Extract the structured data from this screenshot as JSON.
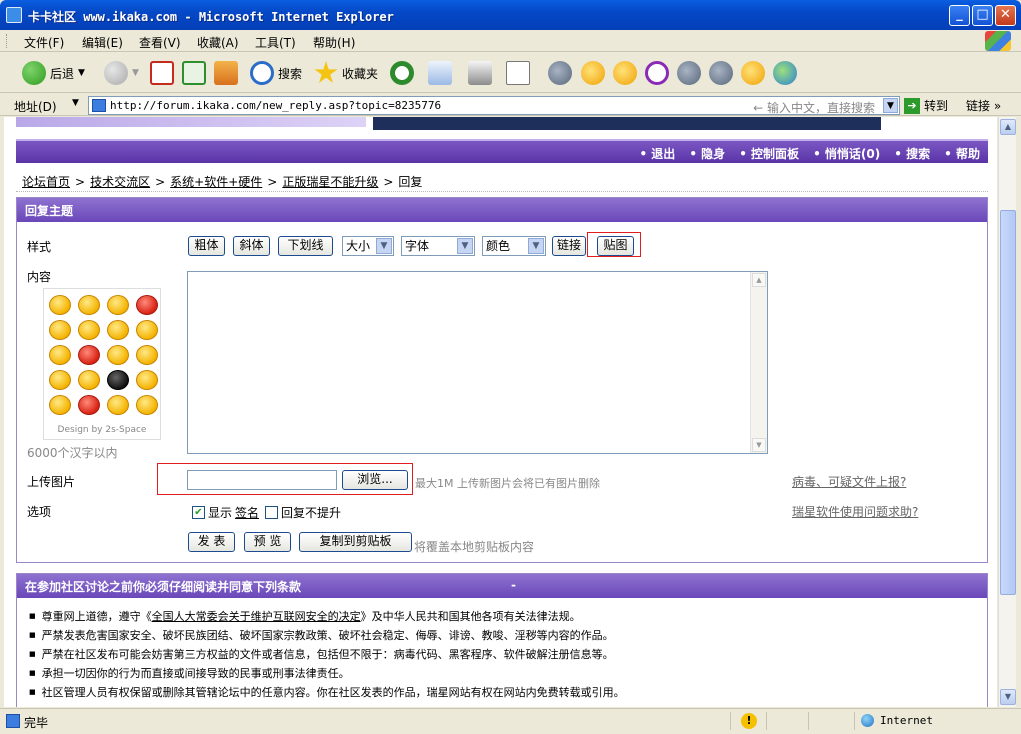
{
  "window": {
    "title": "卡卡社区 www.ikaka.com - Microsoft Internet Explorer",
    "minimize": "_",
    "maximize": "□",
    "close": "✕"
  },
  "menu": [
    "文件(F)",
    "编辑(E)",
    "查看(V)",
    "收藏(A)",
    "工具(T)",
    "帮助(H)"
  ],
  "toolbar": {
    "back": "后退",
    "search": "搜索",
    "favorites": "收藏夹"
  },
  "address": {
    "label": "地址(D)",
    "url": "http://forum.ikaka.com/new_reply.asp?topic=8235776",
    "hint": "← 输入中文，直接搜索",
    "go": "转到",
    "links": "链接 »"
  },
  "site_nav": [
    "退出",
    "隐身",
    "控制面板",
    "悄悄话(0)",
    "搜索",
    "帮助"
  ],
  "breadcrumb": [
    "论坛首页",
    "技术交流区",
    "系统+软件+硬件",
    "正版瑞星不能升级",
    "回复"
  ],
  "reply_form": {
    "header": "回复主题",
    "style_label": "样式",
    "buttons": {
      "bold": "粗体",
      "italic": "斜体",
      "underline": "下划线",
      "link": "链接",
      "image": "贴图"
    },
    "selects": {
      "size": "大小",
      "font": "字体",
      "color": "颜色"
    },
    "content_label": "内容",
    "design_credit": "Design by 2s-Space",
    "char_limit": "6000个汉字以内",
    "upload_label": "上传图片",
    "browse": "浏览...",
    "upload_note": "最大1M 上传新图片会将已有图片删除",
    "virus_link": "病毒、可疑文件上报?",
    "help_link": "瑞星软件使用问题求助?",
    "options_label": "选项",
    "show_signature_pre": "显示",
    "show_signature_link": "签名",
    "no_bump": "回复不提升",
    "show_signature_checked": true,
    "no_bump_checked": false,
    "submit": "发 表",
    "preview": "预 览",
    "copy": "复制到剪贴板",
    "copy_note": "将覆盖本地剪贴板内容"
  },
  "rules": {
    "header": "在参加社区讨论之前你必须仔细阅读并同意下列条款",
    "dash": "-",
    "item1_pre": "尊重网上道德，遵守《",
    "item1_link": "全国人大常委会关于维护互联网安全的决定",
    "item1_post": "》及中华人民共和国其他各项有关法律法规。",
    "items": [
      "严禁发表危害国家安全、破坏民族团结、破坏国家宗教政策、破坏社会稳定、侮辱、诽谤、教唆、淫秽等内容的作品。",
      "严禁在社区发布可能会妨害第三方权益的文件或者信息，包括但不限于：病毒代码、黑客程序、软件破解注册信息等。",
      "承担一切因你的行为而直接或间接导致的民事或刑事法律责任。",
      "社区管理人员有权保留或删除其管辖论坛中的任意内容。你在社区发表的作品，瑞星网站有权在网站内免费转载或引用。"
    ]
  },
  "status": {
    "text": "完毕",
    "warning": "!",
    "zone": "Internet"
  }
}
